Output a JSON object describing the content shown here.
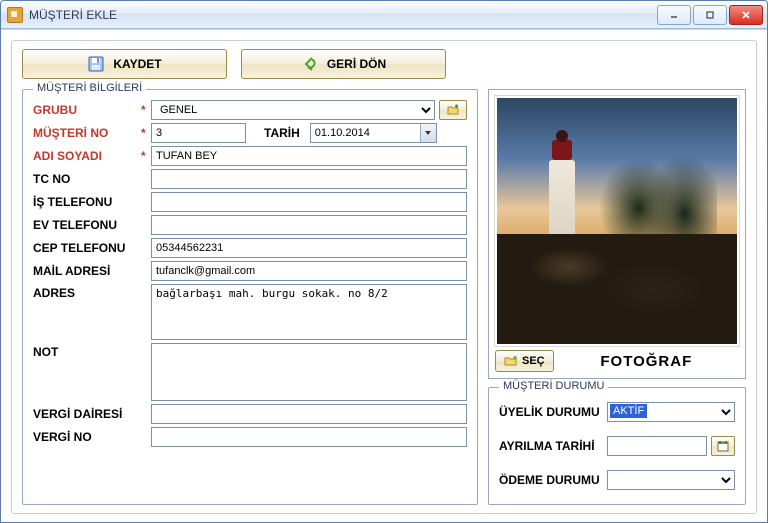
{
  "window": {
    "title": "MÜŞTERİ EKLE"
  },
  "toolbar": {
    "save_label": "KAYDET",
    "back_label": "GERİ DÖN"
  },
  "form": {
    "legend": "MÜŞTERİ BİLGİLERİ",
    "labels": {
      "grubu": "GRUBU",
      "musteri_no": "MÜŞTERİ NO",
      "tarih": "TARİH",
      "adi_soyadi": "ADI SOYADI",
      "tc_no": "TC NO",
      "is_tel": "İŞ TELEFONU",
      "ev_tel": "EV TELEFONU",
      "cep_tel": "CEP TELEFONU",
      "mail": "MAİL ADRESİ",
      "adres": "ADRES",
      "not": "NOT",
      "vergi_dairesi": "VERGİ DAİRESİ",
      "vergi_no": "VERGİ NO"
    },
    "values": {
      "grubu": "GENEL",
      "musteri_no": "3",
      "tarih": "01.10.2014",
      "adi_soyadi": "TUFAN BEY",
      "tc_no": "",
      "is_tel": "",
      "ev_tel": "",
      "cep_tel": "05344562231",
      "mail": "tufanclk@gmail.com",
      "adres": "bağlarbaşı mah. burgu sokak. no 8/2",
      "not": "",
      "vergi_dairesi": "",
      "vergi_no": ""
    }
  },
  "photo": {
    "select_label": "SEÇ",
    "caption": "FOTOĞRAF"
  },
  "status": {
    "legend": "MÜŞTERİ DURUMU",
    "labels": {
      "uyelik": "ÜYELİK DURUMU",
      "ayrilma": "AYRILMA TARİHİ",
      "odeme": "ÖDEME DURUMU"
    },
    "values": {
      "uyelik": "AKTİF",
      "ayrilma": "",
      "odeme": ""
    }
  }
}
